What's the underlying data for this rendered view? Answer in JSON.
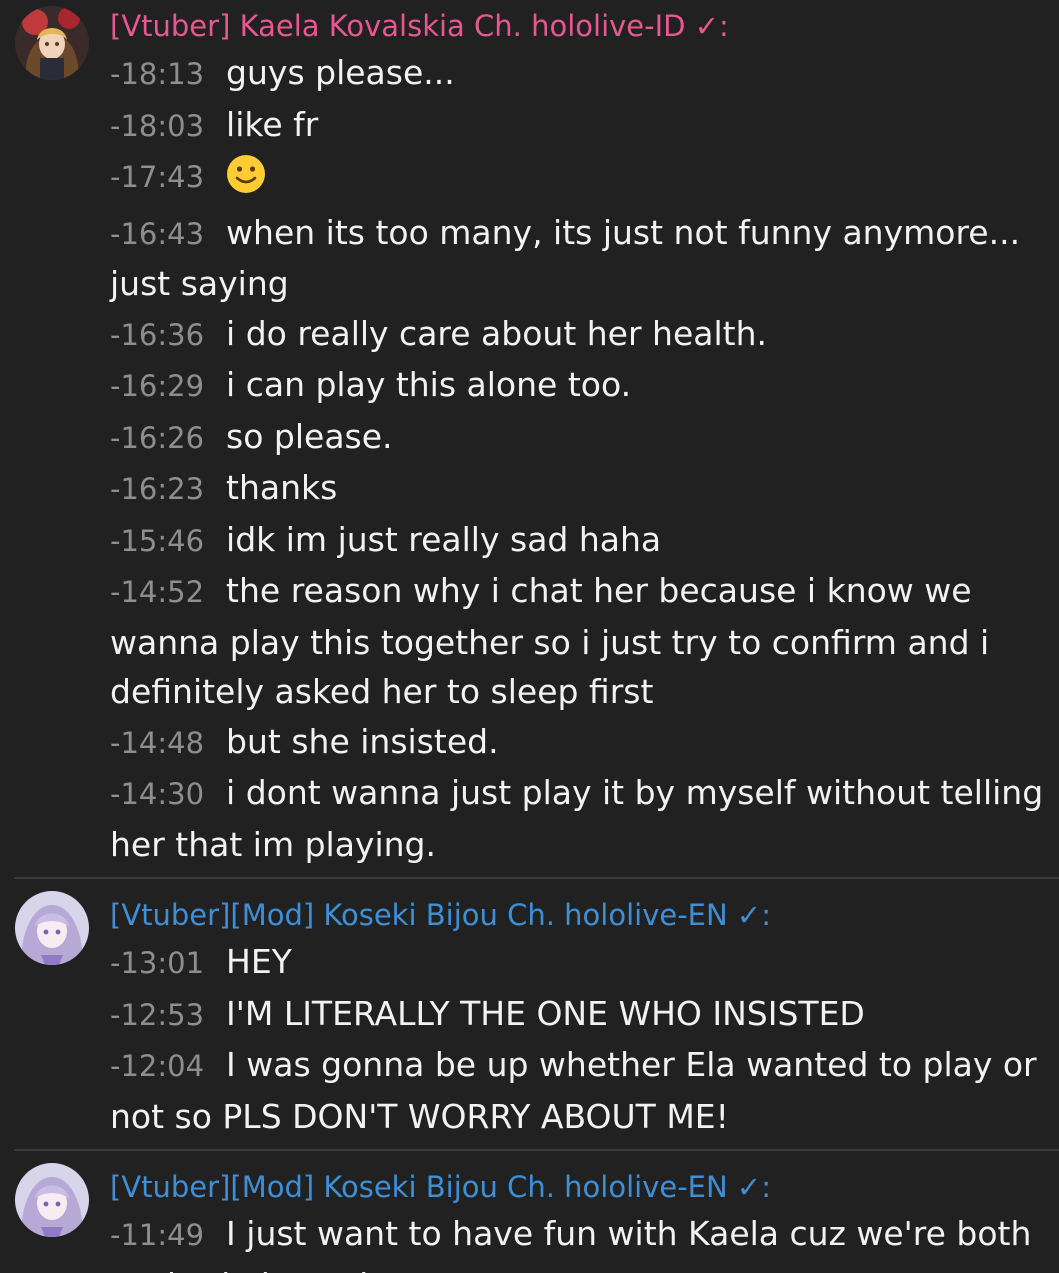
{
  "groups": [
    {
      "author": "[Vtuber] Kaela Kovalskia Ch. hololive-ID",
      "check": "✓",
      "colon": ":",
      "author_color": "#e8578f",
      "avatar_icon": "kaela-avatar",
      "messages": [
        {
          "time": "-18:13",
          "text": "guys please..."
        },
        {
          "time": "-18:03",
          "text": "like fr"
        },
        {
          "time": "-17:43",
          "text": "",
          "emoji": "slightly-smiling-face"
        },
        {
          "time": "-16:43",
          "text": "when its too many, its just not funny anymore... just saying"
        },
        {
          "time": "-16:36",
          "text": "i do really care about her health."
        },
        {
          "time": "-16:29",
          "text": "i can play this alone too."
        },
        {
          "time": "-16:26",
          "text": "so please."
        },
        {
          "time": "-16:23",
          "text": "thanks"
        },
        {
          "time": "-15:46",
          "text": "idk im just really sad haha"
        },
        {
          "time": "-14:52",
          "text": "the reason why i chat her because i know we wanna play this together so i just try to confirm and i definitely asked her to sleep first"
        },
        {
          "time": "-14:48",
          "text": "but she insisted."
        },
        {
          "time": "-14:30",
          "text": "i dont wanna just play it by myself without telling her that im playing."
        }
      ]
    },
    {
      "author": "[Vtuber][Mod] Koseki Bijou Ch. hololive-EN",
      "check": "✓",
      "colon": ":",
      "author_color": "#3e8fd6",
      "avatar_icon": "bijou-avatar",
      "messages": [
        {
          "time": "-13:01",
          "text": "HEY"
        },
        {
          "time": "-12:53",
          "text": "I'M LITERALLY THE ONE WHO INSISTED"
        },
        {
          "time": "-12:04",
          "text": "I was gonna be up whether Ela wanted to play or not so PLS DON'T WORRY ABOUT ME!"
        }
      ]
    },
    {
      "author": "[Vtuber][Mod] Koseki Bijou Ch. hololive-EN",
      "check": "✓",
      "colon": ":",
      "author_color": "#3e8fd6",
      "avatar_icon": "bijou-avatar",
      "messages": [
        {
          "time": "-11:49",
          "text": "I just want to have fun with Kaela cuz we're both excited about the game!"
        }
      ]
    }
  ]
}
